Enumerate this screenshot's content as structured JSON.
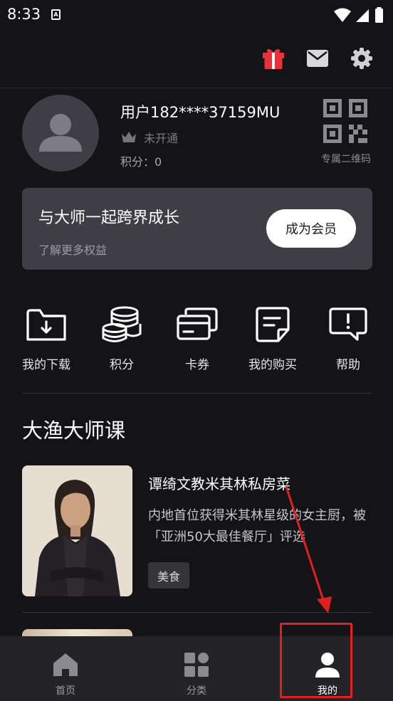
{
  "status_bar": {
    "time": "8:33",
    "notification_icon": "A"
  },
  "header": {
    "icons": [
      "gift-icon",
      "mail-icon",
      "settings-gear-icon"
    ]
  },
  "profile": {
    "username": "用户182****37159MU",
    "member_status": "未开通",
    "points": "积分：0",
    "qr_label": "专属二维码"
  },
  "member_card": {
    "title": "与大师一起跨界成长",
    "subtitle": "了解更多权益",
    "button": "成为会员"
  },
  "actions": [
    {
      "label": "我的下载",
      "icon": "download-folder-icon"
    },
    {
      "label": "积分",
      "icon": "coins-icon"
    },
    {
      "label": "卡券",
      "icon": "cards-icon"
    },
    {
      "label": "我的购买",
      "icon": "purchases-document-icon"
    },
    {
      "label": "帮助",
      "icon": "help-chat-icon"
    }
  ],
  "section": {
    "title": "大渔大师课"
  },
  "course": {
    "title": "谭绮文教米其林私房菜",
    "description": "内地首位获得米其林星级的女主厨，被「亚洲50大最佳餐厅」评选",
    "tag": "美食"
  },
  "bottom_nav": {
    "items": [
      {
        "label": "首页",
        "icon": "home-icon",
        "active": false
      },
      {
        "label": "分类",
        "icon": "category-grid-icon",
        "active": false
      },
      {
        "label": "我的",
        "icon": "profile-person-icon",
        "active": true
      }
    ]
  },
  "colors": {
    "background": "#141317",
    "card": "#3f3e44",
    "gift": "#e8313a",
    "annotation": "#e02020"
  }
}
